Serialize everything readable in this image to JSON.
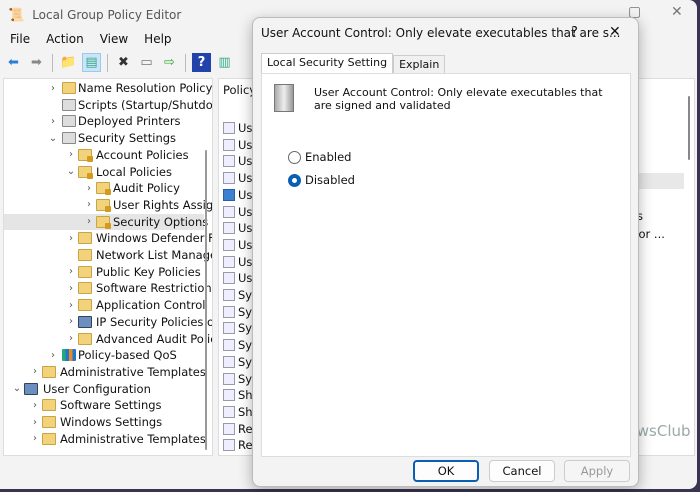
{
  "window": {
    "title": "Local Group Policy Editor",
    "menu": [
      "File",
      "Action",
      "View",
      "Help"
    ],
    "toolbar": [
      "back-icon",
      "forward-icon",
      "up-folder-icon",
      "show-hide-tree-icon",
      "delete-icon",
      "properties-icon",
      "export-icon",
      "help-icon",
      "show-action-pane-icon"
    ]
  },
  "tree": [
    {
      "label": "Name Resolution Policy",
      "level": 2,
      "chev": ">",
      "icon": "folder"
    },
    {
      "label": "Scripts (Startup/Shutdown)",
      "level": 2,
      "chev": "",
      "icon": "script"
    },
    {
      "label": "Deployed Printers",
      "level": 2,
      "chev": ">",
      "icon": "printer"
    },
    {
      "label": "Security Settings",
      "level": 2,
      "chev": "v",
      "icon": "security"
    },
    {
      "label": "Account Policies",
      "level": 3,
      "chev": ">",
      "icon": "lockfolder"
    },
    {
      "label": "Local Policies",
      "level": 3,
      "chev": "v",
      "icon": "lockfolder"
    },
    {
      "label": "Audit Policy",
      "level": 4,
      "chev": ">",
      "icon": "lockfolder"
    },
    {
      "label": "User Rights Assignment",
      "level": 4,
      "chev": ">",
      "icon": "lockfolder"
    },
    {
      "label": "Security Options",
      "level": 4,
      "chev": ">",
      "icon": "lockfolder",
      "selected": true
    },
    {
      "label": "Windows Defender Firewall",
      "level": 3,
      "chev": ">",
      "icon": "folder"
    },
    {
      "label": "Network List Manager",
      "level": 3,
      "chev": "",
      "icon": "folder"
    },
    {
      "label": "Public Key Policies",
      "level": 3,
      "chev": ">",
      "icon": "folder"
    },
    {
      "label": "Software Restriction",
      "level": 3,
      "chev": ">",
      "icon": "folder"
    },
    {
      "label": "Application Control",
      "level": 3,
      "chev": ">",
      "icon": "folder"
    },
    {
      "label": "IP Security Policies o",
      "level": 3,
      "chev": ">",
      "icon": "ipsec"
    },
    {
      "label": "Advanced Audit Polic",
      "level": 3,
      "chev": ">",
      "icon": "folder"
    },
    {
      "label": "Policy-based QoS",
      "level": 2,
      "chev": ">",
      "icon": "chart"
    },
    {
      "label": "Administrative Templates",
      "level": 1,
      "chev": ">",
      "icon": "folder"
    },
    {
      "label": "User Configuration",
      "level": 0,
      "chev": "v",
      "icon": "user"
    },
    {
      "label": "Software Settings",
      "level": 1,
      "chev": ">",
      "icon": "folder"
    },
    {
      "label": "Windows Settings",
      "level": 1,
      "chev": ">",
      "icon": "folder"
    },
    {
      "label": "Administrative Templates",
      "level": 1,
      "chev": ">",
      "icon": "folder"
    }
  ],
  "list": {
    "header": "Policy",
    "items": [
      "Us",
      "Us",
      "Us",
      "Us",
      "Us",
      "Us",
      "Us",
      "Us",
      "Us",
      "Us",
      "Sys",
      "Sys",
      "Sys",
      "Sys",
      "Sys",
      "Sys",
      "Sh",
      "Sh",
      "Re",
      "Re"
    ],
    "highlighted": 4,
    "right_fragments": [
      "tials",
      "nt for ..."
    ]
  },
  "dialog": {
    "title": "User Account Control: Only elevate executables that are s...",
    "help": "?",
    "close": "✕",
    "tabs": [
      "Local Security Setting",
      "Explain"
    ],
    "policy_name": "User Account Control: Only elevate executables that are signed and validated",
    "options": [
      "Enabled",
      "Disabled"
    ],
    "selected": "Disabled",
    "buttons": {
      "ok": "OK",
      "cancel": "Cancel",
      "apply": "Apply"
    }
  },
  "watermark": "TheWindowsClub"
}
